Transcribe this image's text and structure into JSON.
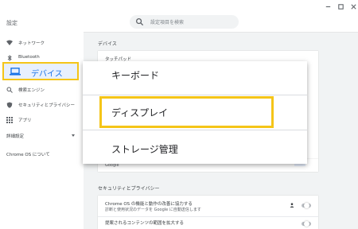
{
  "app": {
    "title": "設定",
    "search_placeholder": "設定項目を検索"
  },
  "sidebar": {
    "items": [
      {
        "label": "ネットワーク",
        "icon": "wifi-icon"
      },
      {
        "label": "Bluetooth",
        "icon": "bluetooth-icon"
      },
      {
        "label": "デバイス",
        "icon": "laptop-icon",
        "selected": true
      },
      {
        "label": "検索エンジン",
        "icon": "search-icon"
      },
      {
        "label": "セキュリティとプライバシー",
        "icon": "shield-icon"
      },
      {
        "label": "アプリ",
        "icon": "apps-grid-icon"
      }
    ],
    "advanced": "詳細設定",
    "about": "Chrome OS について"
  },
  "main": {
    "device_heading": "デバイス",
    "touchpad": "タッチパッド",
    "search_engine_value": "Google",
    "privacy_heading": "セキュリティとプライバシー",
    "privacy_rows": [
      {
        "title": "Chrome OS の機能と動作の改善に協力する",
        "sub": "診断と使用状況のデータを Google に自動送信します"
      },
      {
        "title": "提案されるコンテンツの範囲を拡大する",
        "sub": ""
      }
    ]
  },
  "popup": {
    "items": [
      "キーボード",
      "ディスプレイ",
      "ストレージ管理"
    ]
  },
  "colors": {
    "highlight": "#f5c518",
    "accent": "#1a73e8"
  }
}
